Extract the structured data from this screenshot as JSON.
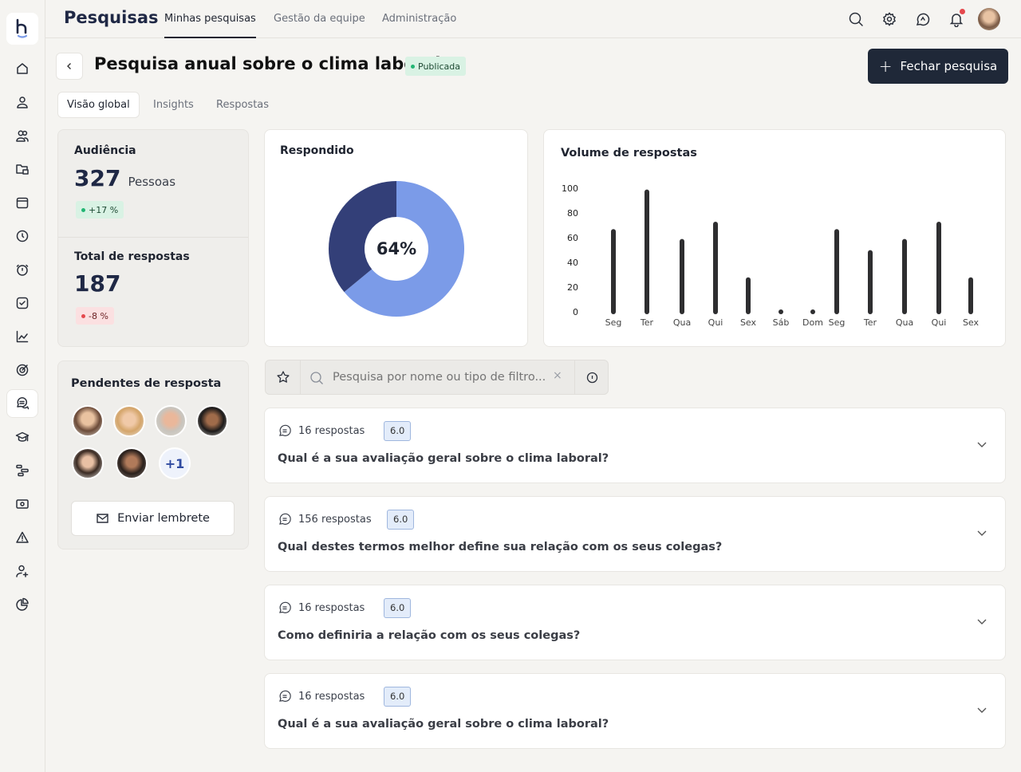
{
  "app": {
    "title": "Pesquisas"
  },
  "nav": [
    "Minhas pesquisas",
    "Gestão da equipe",
    "Administração"
  ],
  "header_icons": [
    "search-icon",
    "gear-icon",
    "chat-sync-icon",
    "bell-icon",
    "avatar"
  ],
  "sidebar": [
    "home-icon",
    "user-icon",
    "users-icon",
    "folder-icon",
    "calendar-icon",
    "clock-icon",
    "stopwatch-icon",
    "checkbox-icon",
    "chart-line-icon",
    "target-icon",
    "chat-icon",
    "graduation-icon",
    "workflow-icon",
    "money-icon",
    "warning-icon",
    "user-add-icon",
    "pie-icon"
  ],
  "page": {
    "title": "Pesquisa anual sobre o clima laboral",
    "status": "Publicada",
    "close_button": "Fechar pesquisa"
  },
  "tabs": [
    "Visão global",
    "Insights",
    "Respostas"
  ],
  "audience": {
    "label": "Audiência",
    "value": "327",
    "unit": "Pessoas",
    "delta": "+17 %"
  },
  "total": {
    "label": "Total de respostas",
    "value": "187",
    "delta": "-8 %"
  },
  "pending": {
    "label": "Pendentes de resposta",
    "more": "+1",
    "button": "Enviar lembrete"
  },
  "colors": {
    "accent_dark": "#333f78",
    "accent_light": "#7b9be8",
    "positive": "#22b573",
    "negative": "#e5484d",
    "primary_button": "#1f2838"
  },
  "answered": {
    "label": "Respondido",
    "percent_label": "64%",
    "percent": 64
  },
  "chart_data": {
    "type": "bar",
    "title": "Volume de respostas",
    "categories": [
      "Seg",
      "Ter",
      "Qua",
      "Qui",
      "Sex",
      "Sáb",
      "Dom",
      "Seg",
      "Ter",
      "Qua",
      "Qui",
      "Sex"
    ],
    "values": [
      65,
      97,
      57,
      71,
      26,
      0,
      0,
      65,
      48,
      57,
      71,
      26
    ],
    "yticks": [
      0,
      20,
      40,
      60,
      80,
      100
    ],
    "ylim": [
      0,
      100
    ],
    "grid": false
  },
  "search": {
    "placeholder": "Pesquisa por nome ou tipo de filtro..."
  },
  "questions": [
    {
      "count": "16 respostas",
      "score": "6.0",
      "text": "Qual é a sua avaliação geral sobre o clima laboral?"
    },
    {
      "count": "156 respostas",
      "score": "6.0",
      "text": "Qual destes termos melhor define sua relação com os seus colegas?"
    },
    {
      "count": "16 respostas",
      "score": "6.0",
      "text": "Como definiria a relação com os seus colegas?"
    },
    {
      "count": "16 respostas",
      "score": "6.0",
      "text": "Qual é a sua avaliação geral sobre o clima laboral?"
    }
  ]
}
